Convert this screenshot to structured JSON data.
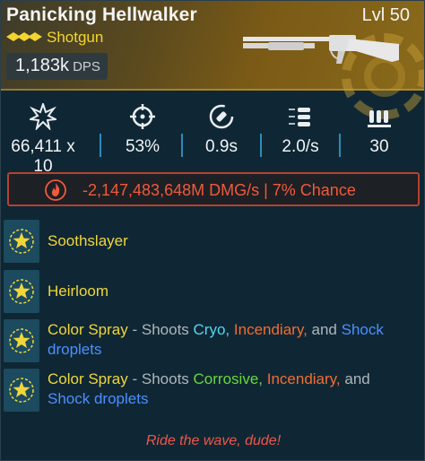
{
  "header": {
    "title": "Panicking Hellwalker",
    "level": "Lvl 50",
    "weapon_type": "Shotgun",
    "dps_value": "1,183k",
    "dps_label": "DPS",
    "rarity_color": "#f3d52f"
  },
  "stats": [
    {
      "icon": "damage-burst-icon",
      "value": "66,411 x 10"
    },
    {
      "icon": "accuracy-crosshair-icon",
      "value": "53%"
    },
    {
      "icon": "reload-time-icon",
      "value": "0.9s"
    },
    {
      "icon": "fire-rate-bullets-icon",
      "value": "2.0/s"
    },
    {
      "icon": "magazine-size-icon",
      "value": "30"
    }
  ],
  "bonus": {
    "icon": "incendiary-flame-icon",
    "text": "-2,147,483,648M DMG/s | 7% Chance",
    "color": "#f05a3b"
  },
  "perks": [
    {
      "name": "Soothslayer"
    },
    {
      "name": "Heirloom"
    },
    {
      "name": "Color Spray",
      "dash": " - ",
      "desc_start": "Shoots ",
      "el1": "Cryo,",
      "el2": "Incendiary,",
      "mid": " and ",
      "el3": "Shock",
      "tail": "droplets"
    },
    {
      "name": "Color Spray",
      "dash": " - ",
      "desc_start": "Shoots ",
      "el1": "Corrosive,",
      "el2": "Incendiary,",
      "mid": " and",
      "el3": "Shock droplets"
    }
  ],
  "flavor_text": "Ride the wave, dude!"
}
